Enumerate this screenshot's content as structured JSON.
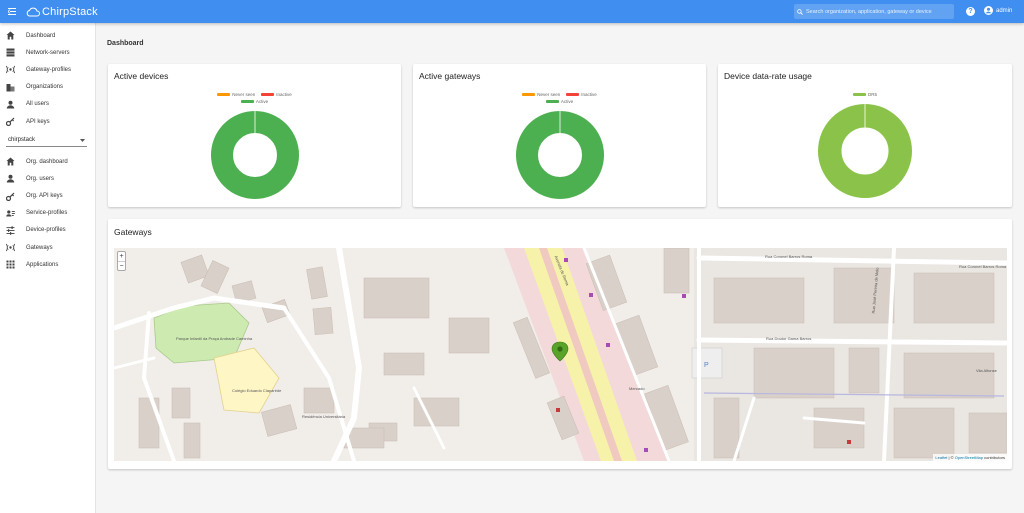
{
  "header": {
    "brand": "ChirpStack",
    "search_placeholder": "Search organization, application, gateway or device",
    "help_label": "?",
    "user_label": "admin"
  },
  "sidebar": {
    "global_items": [
      {
        "label": "Dashboard",
        "icon": "home-icon"
      },
      {
        "label": "Network-servers",
        "icon": "server-icon"
      },
      {
        "label": "Gateway-profiles",
        "icon": "radio-tower-icon"
      },
      {
        "label": "Organizations",
        "icon": "domain-icon"
      },
      {
        "label": "All users",
        "icon": "account-icon"
      },
      {
        "label": "API keys",
        "icon": "key-icon"
      }
    ],
    "org_select": "chirpstack",
    "org_items": [
      {
        "label": "Org. dashboard",
        "icon": "home-icon"
      },
      {
        "label": "Org. users",
        "icon": "account-icon"
      },
      {
        "label": "Org. API keys",
        "icon": "key-icon"
      },
      {
        "label": "Service-profiles",
        "icon": "account-details-icon"
      },
      {
        "label": "Device-profiles",
        "icon": "tune-icon"
      },
      {
        "label": "Gateways",
        "icon": "radio-tower-icon"
      },
      {
        "label": "Applications",
        "icon": "apps-icon"
      }
    ]
  },
  "main": {
    "title": "Dashboard",
    "cards": {
      "active_devices": {
        "title": "Active devices",
        "legend": [
          "Never seen",
          "Inactive",
          "Active"
        ],
        "colors": [
          "#ff9800",
          "#f44336",
          "#4caf50"
        ],
        "values": [
          0,
          0,
          1
        ]
      },
      "active_gateways": {
        "title": "Active gateways",
        "legend": [
          "Never seen",
          "Inactive",
          "Active"
        ],
        "colors": [
          "#ff9800",
          "#f44336",
          "#4caf50"
        ],
        "values": [
          0,
          0,
          1
        ]
      },
      "device_dr": {
        "title": "Device data-rate usage",
        "legend": [
          "DR5"
        ],
        "colors": [
          "#8bc34a"
        ],
        "values": [
          1
        ]
      }
    },
    "gateways": {
      "title": "Gateways",
      "zoom_in": "+",
      "zoom_out": "−",
      "attribution_leaflet": "Leaflet",
      "attribution_sep": " | © ",
      "attribution_osm": "OpenStreetMap",
      "attribution_rest": " contributors",
      "map_labels": {
        "street_1": "Rua Coronel Barros Roma",
        "street_2": "Rua Coronel Barros Roma",
        "street_3": "Rua Doutor Gama Barros",
        "street_4": "Vila Alfonse",
        "street_5": "Rua José Pereira de Melo",
        "street_6": "Avenida de Roma",
        "park": "Parque Infantil da Praça Andrade Caminha",
        "school": "Colégio Eduardo Claparède",
        "residence": "Residência Universitária",
        "market": "Mercado"
      }
    }
  }
}
